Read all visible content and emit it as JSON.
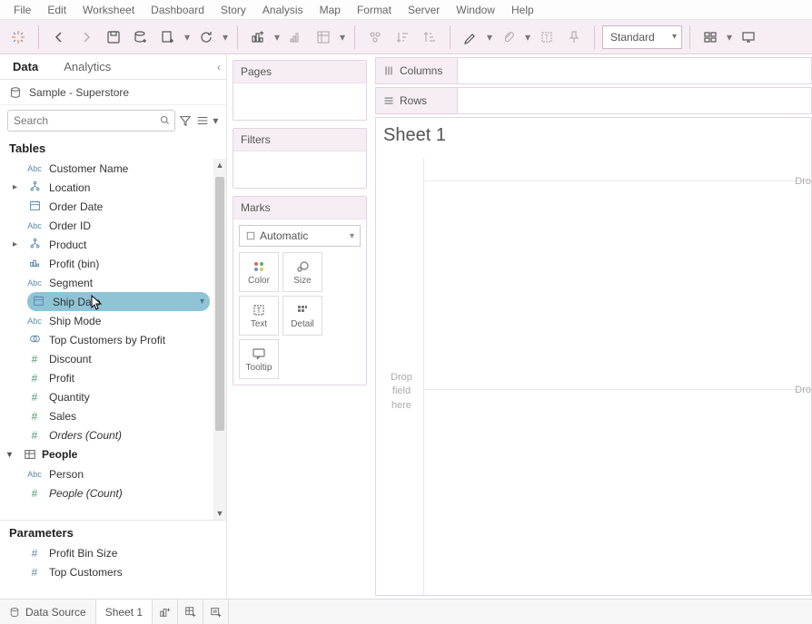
{
  "menu": [
    "File",
    "Edit",
    "Worksheet",
    "Dashboard",
    "Story",
    "Analysis",
    "Map",
    "Format",
    "Server",
    "Window",
    "Help"
  ],
  "toolbar": {
    "fit_mode": "Standard"
  },
  "left": {
    "tab_data": "Data",
    "tab_analytics": "Analytics",
    "datasource": "Sample - Superstore",
    "search_placeholder": "Search",
    "tables_title": "Tables",
    "fields": [
      {
        "icon": "Abc",
        "label": "Customer Name"
      },
      {
        "icon": "hier",
        "label": "Location",
        "expandable": true
      },
      {
        "icon": "date",
        "label": "Order Date"
      },
      {
        "icon": "Abc",
        "label": "Order ID"
      },
      {
        "icon": "hier",
        "label": "Product",
        "expandable": true
      },
      {
        "icon": "bin",
        "label": "Profit (bin)"
      },
      {
        "icon": "Abc",
        "label": "Segment"
      },
      {
        "icon": "date",
        "label": "Ship Date",
        "selected": true
      },
      {
        "icon": "Abc",
        "label": "Ship Mode"
      },
      {
        "icon": "set",
        "label": "Top Customers by Profit"
      },
      {
        "icon": "#",
        "label": "Discount",
        "measure": true
      },
      {
        "icon": "#",
        "label": "Profit",
        "measure": true
      },
      {
        "icon": "#",
        "label": "Quantity",
        "measure": true
      },
      {
        "icon": "#",
        "label": "Sales",
        "measure": true
      },
      {
        "icon": "#",
        "label": "Orders (Count)",
        "measure": true,
        "italic": true
      }
    ],
    "group_people": "People",
    "people_fields": [
      {
        "icon": "Abc",
        "label": "Person"
      },
      {
        "icon": "#",
        "label": "People (Count)",
        "measure": true,
        "italic": true
      }
    ],
    "parameters_title": "Parameters",
    "parameters": [
      {
        "icon": "#",
        "label": "Profit Bin Size"
      },
      {
        "icon": "#",
        "label": "Top Customers"
      }
    ]
  },
  "shelves": {
    "pages": "Pages",
    "filters": "Filters",
    "marks": "Marks",
    "marks_type": "Automatic",
    "mark_btns": [
      "Color",
      "Size",
      "Text",
      "Detail",
      "Tooltip"
    ],
    "columns": "Columns",
    "rows": "Rows"
  },
  "viz": {
    "sheet_title": "Sheet 1",
    "drop_hint": "Drop field here",
    "drop_hint_r1": "Dro",
    "drop_hint_r2": "Dro"
  },
  "bottom": {
    "data_source": "Data Source",
    "sheet1": "Sheet 1"
  }
}
